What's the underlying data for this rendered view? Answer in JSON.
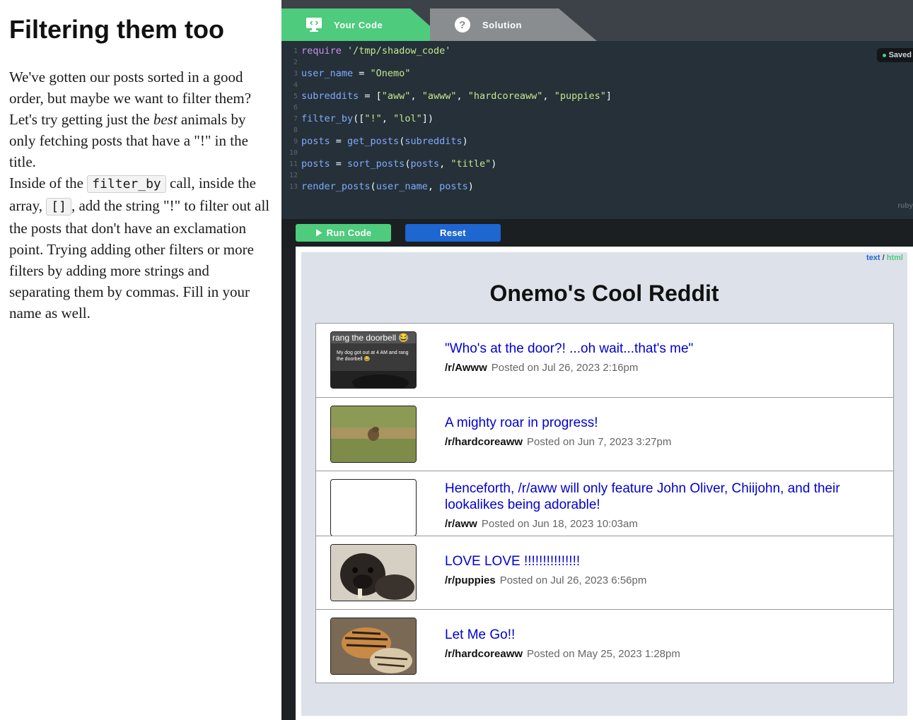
{
  "lesson": {
    "title": "Filtering them too",
    "p1_a": "We've gotten our posts sorted in a good order, but maybe we want to filter them? Let's try getting just the ",
    "p1_em": "best",
    "p1_b": " animals by only fetching posts that have a \"!\" in the title.",
    "p2_a": "Inside of the ",
    "p2_code1": "filter_by",
    "p2_b": " call, inside the array, ",
    "p2_code2": "[]",
    "p2_c": ", add the string \"!\" to filter out all the posts that don't have an exclamation point. Trying adding other filters or more filters by adding more strings and separating them by commas. Fill in your name as well."
  },
  "ide": {
    "tabs": {
      "code": "Your Code",
      "solution": "Solution"
    },
    "saved": "Saved",
    "runtime": "ruby",
    "code_lines": {
      "l1_kw": "require",
      "l1_str": "'/tmp/shadow_code'",
      "l3_var": "user_name",
      "l3_op": " = ",
      "l3_str": "\"Onemo\"",
      "l5_var": "subreddits",
      "l5_op": " = [",
      "l5_s1": "\"aww\"",
      "l5_c1": ", ",
      "l5_s2": "\"awww\"",
      "l5_c2": ", ",
      "l5_s3": "\"hardcoreaww\"",
      "l5_c3": ", ",
      "l5_s4": "\"puppies\"",
      "l5_end": "]",
      "l7_fn": "filter_by",
      "l7_op": "([",
      "l7_s1": "\"!\"",
      "l7_c1": ", ",
      "l7_s2": "\"lol\"",
      "l7_end": "])",
      "l9_var": "posts",
      "l9_op": " = ",
      "l9_fn": "get_posts",
      "l9_p1": "(",
      "l9_arg": "subreddits",
      "l9_p2": ")",
      "l11_var": "posts",
      "l11_op": " = ",
      "l11_fn": "sort_posts",
      "l11_p1": "(",
      "l11_arg": "posts",
      "l11_c": ", ",
      "l11_str": "\"title\"",
      "l11_p2": ")",
      "l13_fn": "render_posts",
      "l13_p1": "(",
      "l13_a1": "user_name",
      "l13_c": ", ",
      "l13_a2": "posts",
      "l13_p2": ")"
    },
    "line_numbers": [
      "1",
      "2",
      "3",
      "4",
      "5",
      "6",
      "7",
      "8",
      "9",
      "10",
      "11",
      "12",
      "13"
    ],
    "run_label": "Run Code",
    "reset_label": "Reset",
    "view_text": "text",
    "view_sep": " / ",
    "view_html": "html"
  },
  "preview": {
    "title": "Onemo's Cool Reddit",
    "thumb1_overlay": "rang the doorbell 😂",
    "thumb1_caption": "My dog got out at 4 AM and rang the doorbell 😂",
    "posts": [
      {
        "title": "\"Who's at the door?! ...oh wait...that's me\"",
        "subreddit": "/r/Awww",
        "posted": "Posted on Jul 26, 2023 2:16pm"
      },
      {
        "title": "A mighty roar in progress!",
        "subreddit": "/r/hardcoreaww",
        "posted": "Posted on Jun 7, 2023 3:27pm"
      },
      {
        "title": "Henceforth, /r/aww will only feature John Oliver, Chiijohn, and their lookalikes being adorable!",
        "subreddit": "/r/aww",
        "posted": "Posted on Jun 18, 2023 10:03am"
      },
      {
        "title": "LOVE LOVE !!!!!!!!!!!!!!!",
        "subreddit": "/r/puppies",
        "posted": "Posted on Jul 26, 2023 6:56pm"
      },
      {
        "title": "Let Me Go!!",
        "subreddit": "/r/hardcoreaww",
        "posted": "Posted on May 25, 2023 1:28pm"
      }
    ]
  },
  "colors": {
    "green": "#4ecb7d",
    "blue": "#1e66d0",
    "link": "#0000d0"
  }
}
